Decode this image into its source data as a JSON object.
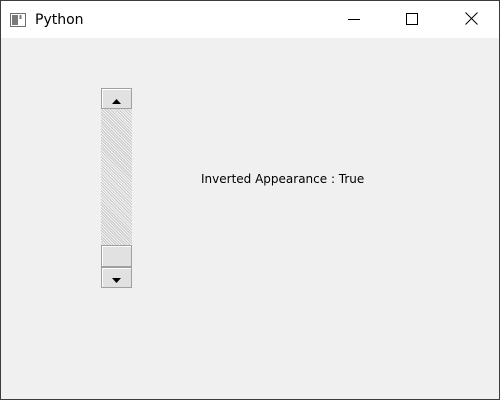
{
  "window": {
    "title": "Python"
  },
  "titlebar": {
    "icons": {
      "app": "app-window-icon",
      "minimize": "minimize-icon",
      "maximize": "maximize-icon",
      "close": "close-icon"
    }
  },
  "scrollbar": {
    "orientation": "vertical",
    "position": 1.0,
    "icons": {
      "up": "arrow-up-icon",
      "down": "arrow-down-icon"
    }
  },
  "label": {
    "text": "Inverted Appearance : True"
  }
}
